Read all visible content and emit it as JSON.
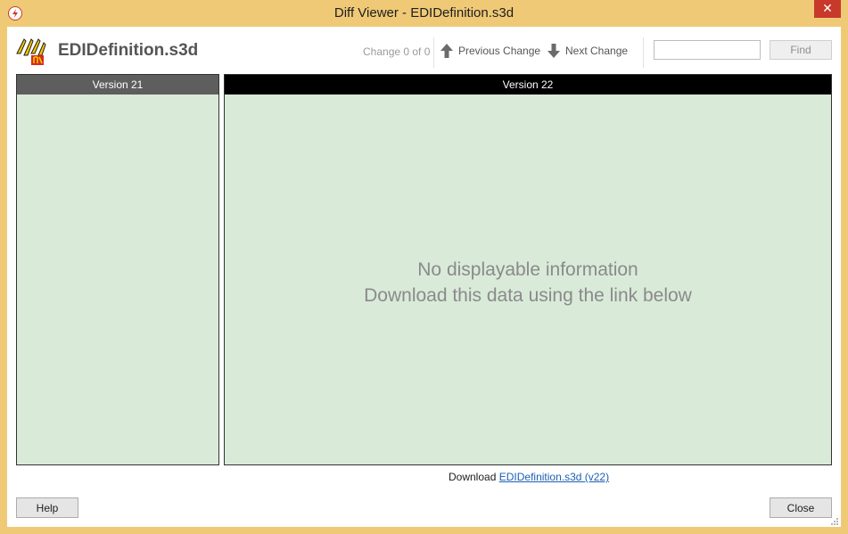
{
  "window": {
    "title": "Diff Viewer - EDIDefinition.s3d",
    "close_glyph": "✕"
  },
  "header": {
    "filename": "EDIDefinition.s3d",
    "change_count": "Change 0 of 0",
    "previous_label": "Previous Change",
    "next_label": "Next Change",
    "search_value": "",
    "find_label": "Find"
  },
  "panes": {
    "left_title": "Version 21",
    "right_title": "Version 22",
    "message_line1": "No displayable information",
    "message_line2": "Download this data using the link below"
  },
  "footer": {
    "download_prefix": "Download",
    "download_link": "EDIDefinition.s3d (v22)",
    "help_label": "Help",
    "close_label": "Close"
  },
  "colors": {
    "title_bar": "#f0c977",
    "pane_background": "#d9ead9",
    "close_button": "#c8392b",
    "link": "#1a5fb4"
  }
}
